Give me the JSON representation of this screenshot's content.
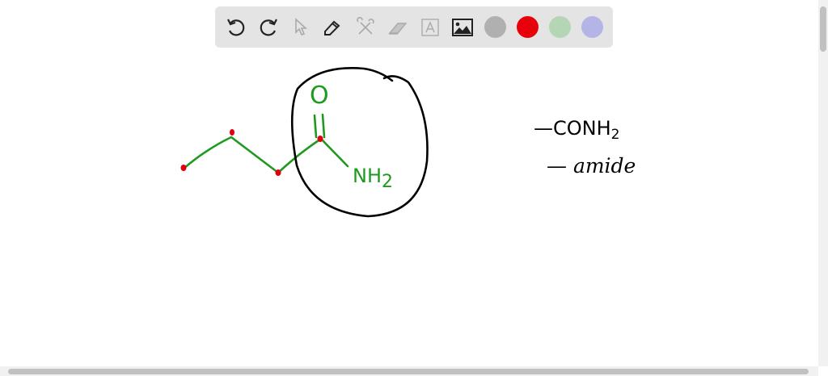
{
  "toolbar": {
    "tools": [
      "undo-icon",
      "redo-icon",
      "select-icon",
      "pen-icon",
      "tools-icon",
      "eraser-icon",
      "text-icon",
      "image-icon"
    ],
    "colors": {
      "gray": "#b0b0b0",
      "red": "#e8000b",
      "green": "#b4d6b4",
      "purple": "#b4b4e6"
    }
  },
  "drawing": {
    "oxygen_label": "O",
    "amine_label": "NH",
    "amine_subscript": "2",
    "note_line1": "—CONH",
    "note_line1_sub": "2",
    "note_line2": "— amide",
    "ink_green": "#1e9a1e",
    "ink_red": "#e00010",
    "ink_black": "#000000"
  }
}
